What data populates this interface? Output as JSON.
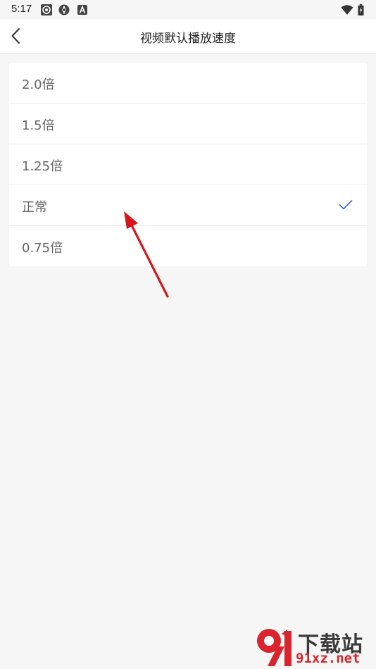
{
  "status_bar": {
    "time": "5:17"
  },
  "header": {
    "title": "视频默认播放速度"
  },
  "speed_options": [
    {
      "label": "2.0倍",
      "selected": false
    },
    {
      "label": "1.5倍",
      "selected": false
    },
    {
      "label": "1.25倍",
      "selected": false
    },
    {
      "label": "正常",
      "selected": true
    },
    {
      "label": "0.75倍",
      "selected": false
    }
  ],
  "watermark": {
    "text_top": "下载站",
    "text_bottom": "91xz.net"
  },
  "colors": {
    "accent": "#3f6db5",
    "arrow": "#d4161c",
    "watermark_red": "#d9232d"
  }
}
